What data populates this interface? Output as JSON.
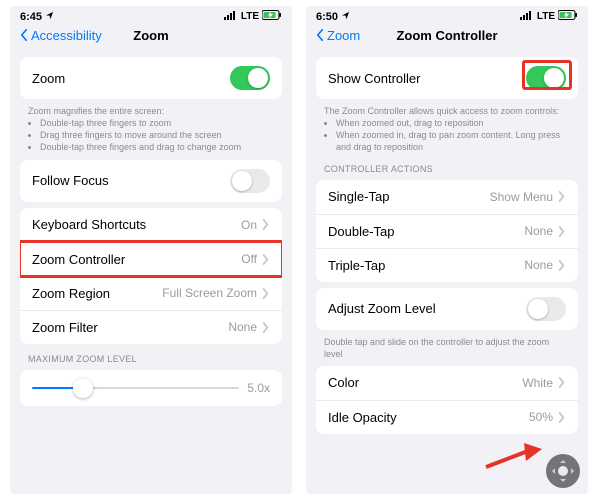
{
  "left": {
    "status": {
      "time": "6:45",
      "net": "LTE"
    },
    "nav": {
      "back": "Accessibility",
      "title": "Zoom"
    },
    "zoom_row": {
      "label": "Zoom",
      "on": true
    },
    "zoom_desc": {
      "lead": "Zoom magnifies the entire screen:",
      "bullets": [
        "Double-tap three fingers to zoom",
        "Drag three fingers to move around the screen",
        "Double-tap three fingers and drag to change zoom"
      ]
    },
    "follow": {
      "label": "Follow Focus",
      "on": false
    },
    "items": [
      {
        "label": "Keyboard Shortcuts",
        "value": "On"
      },
      {
        "label": "Zoom Controller",
        "value": "Off"
      },
      {
        "label": "Zoom Region",
        "value": "Full Screen Zoom"
      },
      {
        "label": "Zoom Filter",
        "value": "None"
      }
    ],
    "max_hdr": "MAXIMUM ZOOM LEVEL",
    "max_val": "5.0x"
  },
  "right": {
    "status": {
      "time": "6:50",
      "net": "LTE"
    },
    "nav": {
      "back": "Zoom",
      "title": "Zoom Controller"
    },
    "show": {
      "label": "Show Controller",
      "on": true
    },
    "show_desc": {
      "lead": "The Zoom Controller allows quick access to zoom controls:",
      "bullets": [
        "When zoomed out, drag to reposition",
        "When zoomed in, drag to pan zoom content. Long press and drag to reposition"
      ]
    },
    "actions_hdr": "CONTROLLER ACTIONS",
    "actions": [
      {
        "label": "Single-Tap",
        "value": "Show Menu"
      },
      {
        "label": "Double-Tap",
        "value": "None"
      },
      {
        "label": "Triple-Tap",
        "value": "None"
      }
    ],
    "adjust": {
      "label": "Adjust Zoom Level",
      "on": false
    },
    "adjust_desc": "Double tap and slide on the controller to adjust the zoom level",
    "appearance": [
      {
        "label": "Color",
        "value": "White"
      },
      {
        "label": "Idle Opacity",
        "value": "50%"
      }
    ]
  }
}
